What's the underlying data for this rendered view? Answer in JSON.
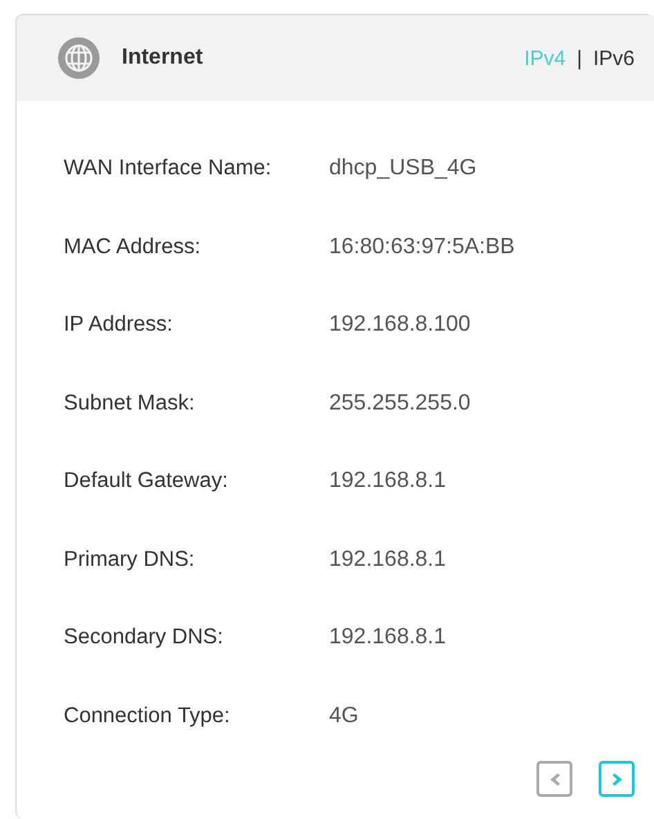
{
  "card": {
    "title": "Internet",
    "tabs": [
      {
        "label": "IPv4",
        "selected": true
      },
      {
        "label": "IPv6",
        "selected": false
      }
    ],
    "separator": "|"
  },
  "fields": [
    {
      "label": "WAN Interface Name:",
      "value": "dhcp_USB_4G"
    },
    {
      "label": "MAC Address:",
      "value": "16:80:63:97:5A:BB"
    },
    {
      "label": "IP Address:",
      "value": "192.168.8.100"
    },
    {
      "label": "Subnet Mask:",
      "value": "255.255.255.0"
    },
    {
      "label": "Default Gateway:",
      "value": "192.168.8.1"
    },
    {
      "label": "Primary DNS:",
      "value": "192.168.8.1"
    },
    {
      "label": "Secondary DNS:",
      "value": "192.168.8.1"
    },
    {
      "label": "Connection Type:",
      "value": "4G"
    }
  ],
  "pager": [
    {
      "kind": "prev",
      "disabled": true
    },
    {
      "kind": "next",
      "disabled": false
    }
  ]
}
